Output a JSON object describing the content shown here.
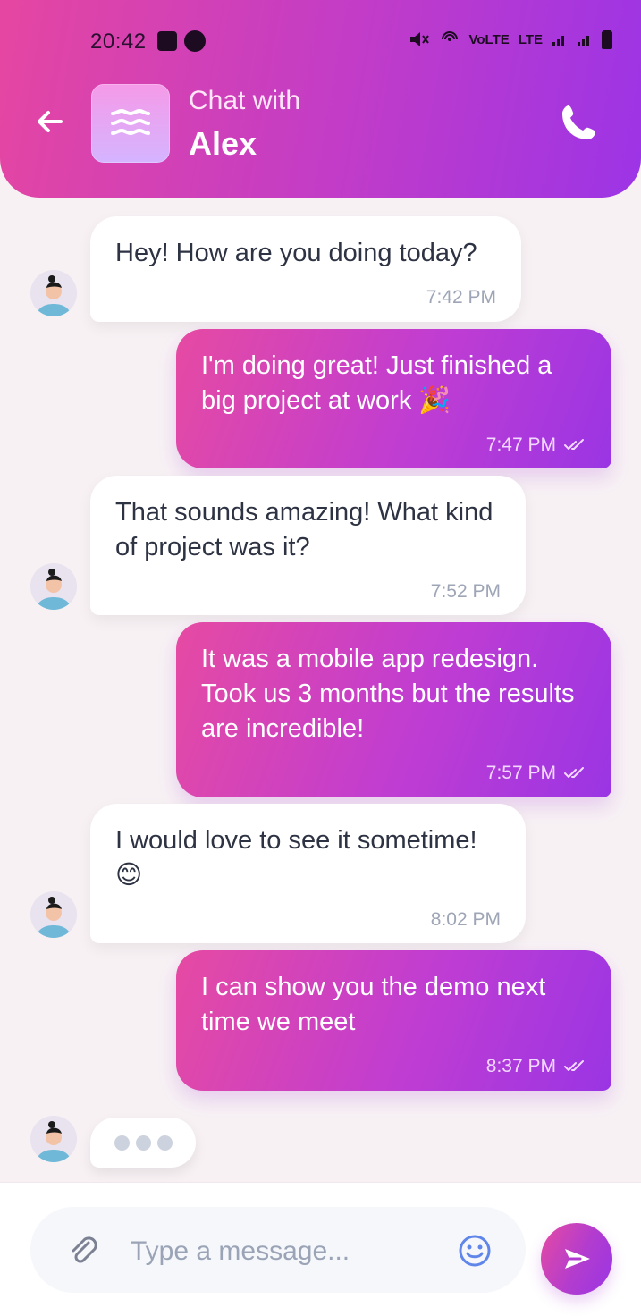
{
  "status_bar": {
    "time": "20:42",
    "icons_left": [
      "image-icon",
      "app-badge-icon"
    ],
    "icons_right": [
      "mute-icon",
      "hotspot-icon",
      "volte-icon",
      "lte-icon",
      "signal-bars-icon",
      "signal-bars-icon-2",
      "battery-icon"
    ],
    "network_text_1": "VoLTE",
    "network_text_2": "LTE"
  },
  "header": {
    "subtitle": "Chat with",
    "contact_name": "Alex",
    "back_icon": "arrow-left-icon",
    "call_icon": "phone-icon"
  },
  "messages": [
    {
      "direction": "incoming",
      "text": "Hey! How are you doing today?",
      "time": "7:42 PM"
    },
    {
      "direction": "outgoing",
      "text": "I'm doing great! Just finished a big project at work 🎉",
      "time": "7:47 PM"
    },
    {
      "direction": "incoming",
      "text": "That sounds amazing! What kind of project was it?",
      "time": "7:52 PM"
    },
    {
      "direction": "outgoing",
      "text": "It was a mobile app redesign. Took us 3 months but the results are incredible!",
      "time": "7:57 PM"
    },
    {
      "direction": "incoming",
      "text": "I would love to see it sometime! 😊",
      "time": "8:02 PM"
    },
    {
      "direction": "outgoing",
      "text": "I can show you the demo next time we meet",
      "time": "8:37 PM"
    }
  ],
  "typing_indicator": {
    "visible": true
  },
  "composer": {
    "placeholder": "Type a message...",
    "value": "",
    "attach_icon": "paperclip-icon",
    "emoji_icon": "smiley-icon",
    "send_icon": "send-icon"
  },
  "colors": {
    "gradient_start": "#e546a1",
    "gradient_mid": "#c13cc8",
    "gradient_end": "#9c34e6",
    "background": "#f7f1f4",
    "incoming_bubble": "#ffffff",
    "incoming_text": "#2e3343",
    "time_gray": "#9ea5b6"
  }
}
